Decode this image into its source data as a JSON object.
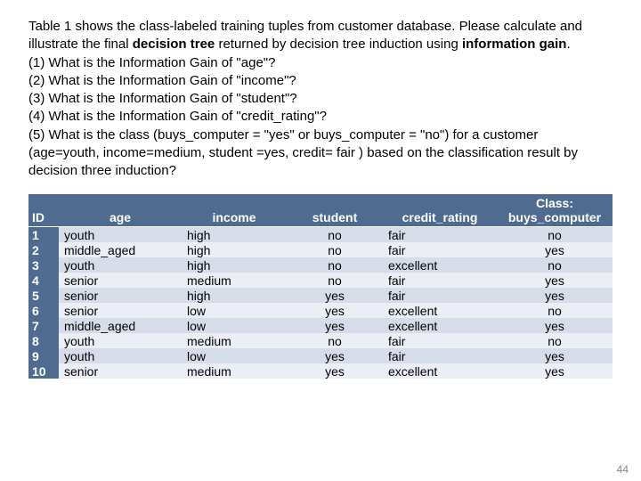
{
  "text": {
    "p1a": "Table 1 shows the class-labeled training tuples from customer database. Please calculate and illustrate the final ",
    "p1b": "decision tree",
    "p1c": " returned by decision tree induction using ",
    "p1d": "information gain",
    "p1e": ".",
    "q1": "(1) What is the Information Gain of \"age\"?",
    "q2": "(2) What is the Information Gain of \"income\"?",
    "q3": "(3) What is the Information Gain of \"student\"?",
    "q4": "(4) What is the Information Gain of \"credit_rating\"?",
    "q5": "(5) What is the class (buys_computer = \"yes\" or buys_computer = \"no\") for a customer (age=youth, income=medium, student =yes, credit= fair ) based on the classification result by decision three induction?"
  },
  "headers": {
    "id": "ID",
    "age": "age",
    "income": "income",
    "student": "student",
    "credit": "credit_rating",
    "class_line1": "Class:",
    "class_line2": "buys_computer"
  },
  "rows": [
    {
      "id": "1",
      "age": "youth",
      "income": "high",
      "student": "no",
      "credit": "fair",
      "cls": "no"
    },
    {
      "id": "2",
      "age": "middle_aged",
      "income": "high",
      "student": "no",
      "credit": "fair",
      "cls": "yes"
    },
    {
      "id": "3",
      "age": "youth",
      "income": "high",
      "student": "no",
      "credit": "excellent",
      "cls": "no"
    },
    {
      "id": "4",
      "age": "senior",
      "income": "medium",
      "student": "no",
      "credit": "fair",
      "cls": "yes"
    },
    {
      "id": "5",
      "age": "senior",
      "income": "high",
      "student": "yes",
      "credit": "fair",
      "cls": "yes"
    },
    {
      "id": "6",
      "age": "senior",
      "income": "low",
      "student": "yes",
      "credit": "excellent",
      "cls": "no"
    },
    {
      "id": "7",
      "age": "middle_aged",
      "income": "low",
      "student": "yes",
      "credit": "excellent",
      "cls": "yes"
    },
    {
      "id": "8",
      "age": "youth",
      "income": "medium",
      "student": "no",
      "credit": "fair",
      "cls": "no"
    },
    {
      "id": "9",
      "age": "youth",
      "income": "low",
      "student": "yes",
      "credit": "fair",
      "cls": "yes"
    },
    {
      "id": "10",
      "age": "senior",
      "income": "medium",
      "student": "yes",
      "credit": "excellent",
      "cls": "yes"
    }
  ],
  "page_number": "44"
}
